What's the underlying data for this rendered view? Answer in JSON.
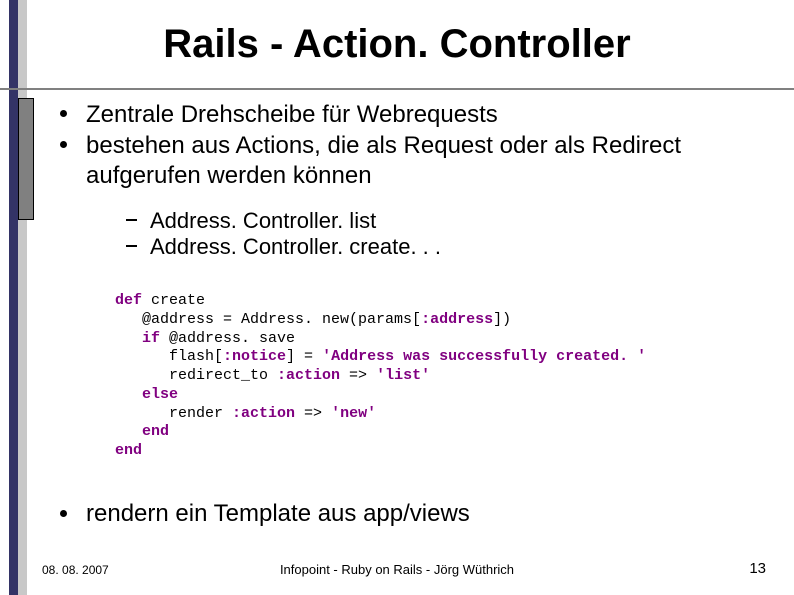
{
  "title": "Rails - Action. Controller",
  "bullets": [
    "Zentrale Drehscheibe für Webrequests",
    "bestehen aus Actions, die als Request oder als Redirect aufgerufen werden können"
  ],
  "subbullets": [
    "Address. Controller. list",
    "Address. Controller. create. . ."
  ],
  "code": {
    "l1a": "def",
    "l1b": " create",
    "l2a": "   @address = Address. new(params[",
    "l2b": ":address",
    "l2c": "])",
    "l3a": "   ",
    "l3b": "if",
    "l3c": " @address. save",
    "l4a": "      flash[",
    "l4b": ":notice",
    "l4c": "] = ",
    "l4d": "'Address was successfully created. '",
    "l5a": "      redirect_to ",
    "l5b": ":action",
    "l5c": " => ",
    "l5d": "'list'",
    "l6a": "   ",
    "l6b": "else",
    "l7a": "      render ",
    "l7b": ":action",
    "l7c": " => ",
    "l7d": "'new'",
    "l8a": "   ",
    "l8b": "end",
    "l9a": "end"
  },
  "last_bullet": "rendern ein Template aus app/views",
  "footer": {
    "date": "08. 08. 2007",
    "center": "Infopoint - Ruby on Rails - Jörg Wüthrich",
    "page": "13"
  }
}
